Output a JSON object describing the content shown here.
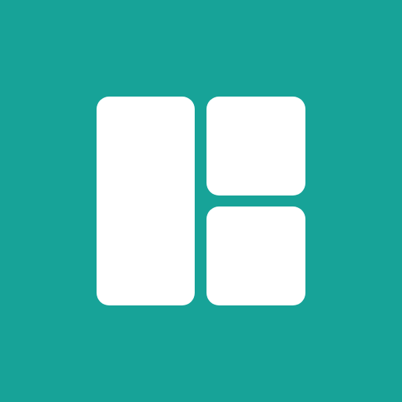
{
  "app_icon": {
    "background_color": "#17a398",
    "tile_color": "#ffffff",
    "icon_name": "layout-grid-icon"
  }
}
